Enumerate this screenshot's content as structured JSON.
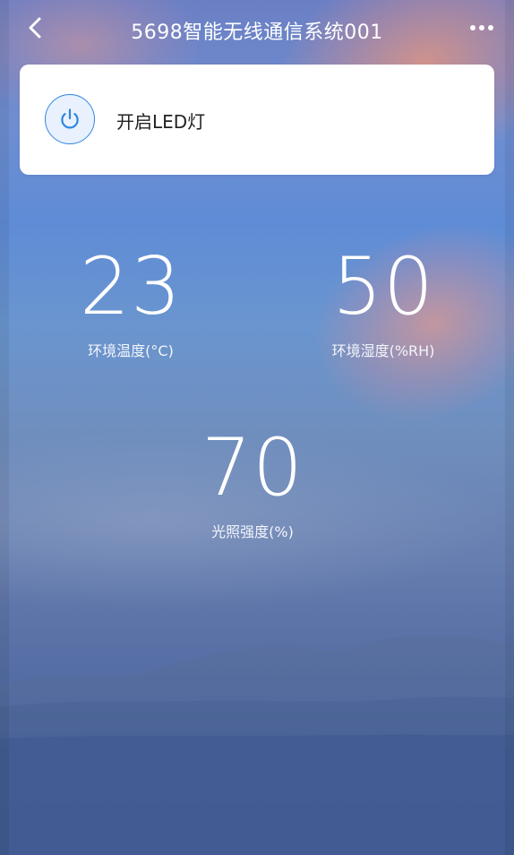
{
  "header": {
    "title": "5698智能无线通信系统001"
  },
  "icons": {
    "back": "chevron-left-icon",
    "more": "more-horizontal-icon",
    "power": "power-icon"
  },
  "led_card": {
    "label": "开启LED灯",
    "accent_color": "#2f86e4"
  },
  "sensors": [
    {
      "value": "23",
      "label": "环境温度(°C)"
    },
    {
      "value": "50",
      "label": "环境湿度(%RH)"
    },
    {
      "value": "70",
      "label": "光照强度(%)"
    }
  ]
}
